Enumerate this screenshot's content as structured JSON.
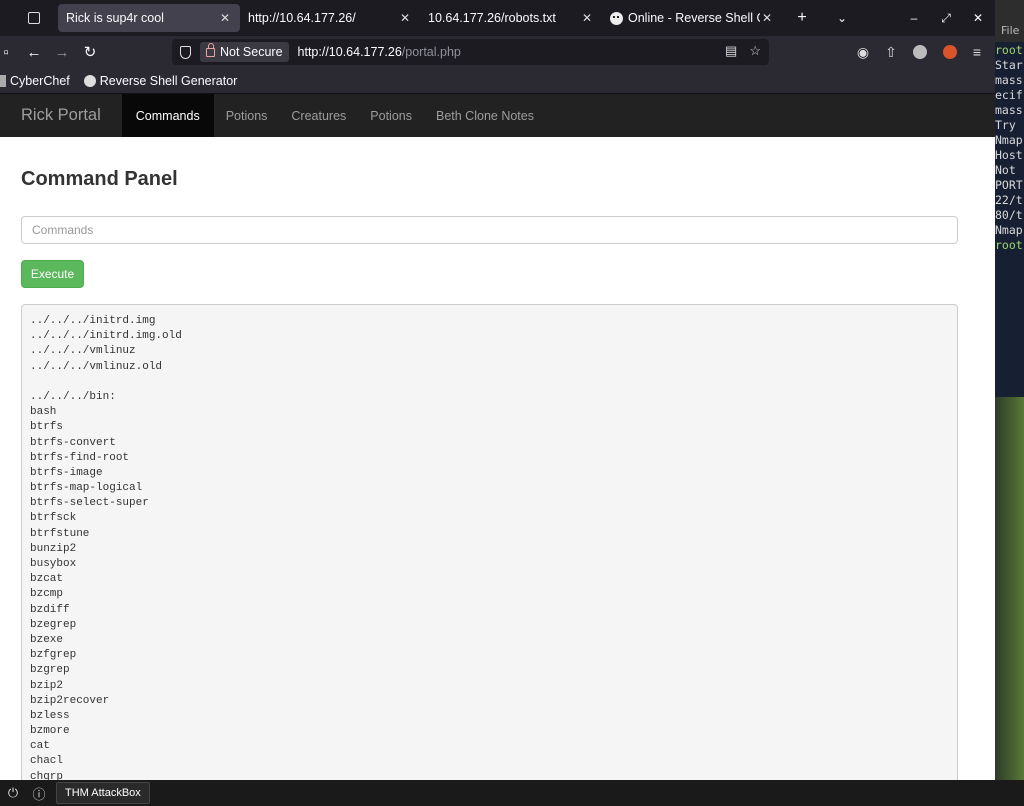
{
  "browser": {
    "tabs": [
      {
        "label": "Rick is sup4r cool",
        "active": true
      },
      {
        "label": "http://10.64.177.26/",
        "active": false
      },
      {
        "label": "10.64.177.26/robots.txt",
        "active": false
      },
      {
        "label": "Online - Reverse Shell Ge",
        "active": false
      }
    ],
    "url_security": "Not Secure",
    "url_host": "http://10.64.177.26",
    "url_path": "/portal.php",
    "bookmarks": [
      "CyberChef",
      "Reverse Shell Generator"
    ]
  },
  "site": {
    "brand": "Rick Portal",
    "nav": [
      "Commands",
      "Potions",
      "Creatures",
      "Potions",
      "Beth Clone Notes"
    ],
    "panel_title": "Command Panel",
    "input_placeholder": "Commands",
    "execute_label": "Execute",
    "output_lines": [
      "../../../initrd.img",
      "../../../initrd.img.old",
      "../../../vmlinuz",
      "../../../vmlinuz.old",
      "",
      "../../../bin:",
      "bash",
      "btrfs",
      "btrfs-convert",
      "btrfs-find-root",
      "btrfs-image",
      "btrfs-map-logical",
      "btrfs-select-super",
      "btrfsck",
      "btrfstune",
      "bunzip2",
      "busybox",
      "bzcat",
      "bzcmp",
      "bzdiff",
      "bzegrep",
      "bzexe",
      "bzfgrep",
      "bzgrep",
      "bzip2",
      "bzip2recover",
      "bzless",
      "bzmore",
      "cat",
      "chacl",
      "chgrp"
    ]
  },
  "terminal": {
    "menu": "File",
    "lines": [
      {
        "text": "root",
        "green": true
      },
      {
        "text": "Star",
        "green": false
      },
      {
        "text": "mass",
        "green": false
      },
      {
        "text": "ecif",
        "green": false
      },
      {
        "text": "mass",
        "green": false
      },
      {
        "text": " Try",
        "green": false
      },
      {
        "text": "Nmap",
        "green": false
      },
      {
        "text": "Host",
        "green": false
      },
      {
        "text": "Not ",
        "green": false
      },
      {
        "text": "PORT",
        "green": false
      },
      {
        "text": "22/t",
        "green": false
      },
      {
        "text": "80/t",
        "green": false
      },
      {
        "text": "",
        "green": false
      },
      {
        "text": "Nmap",
        "green": false
      },
      {
        "text": "root",
        "green": true
      }
    ]
  },
  "taskbar": {
    "app_label": "THM AttackBox"
  }
}
